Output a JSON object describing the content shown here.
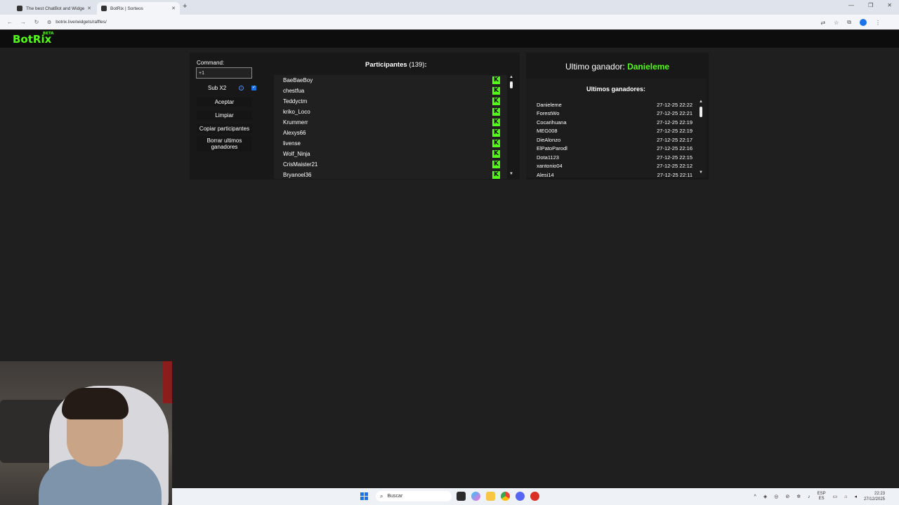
{
  "browser": {
    "tabs": [
      {
        "title": "The best ChatBot and Widgets"
      },
      {
        "title": "BotRix | Sorteos"
      }
    ],
    "url": "botrix.live/widgets/raffles/"
  },
  "app": {
    "logo": "BotRix",
    "logo_badge": "BETA"
  },
  "controls": {
    "command_label": "Command:",
    "command_value": "+1",
    "sub_label": "Sub X2",
    "sub_checked": true,
    "accept_label": "Aceptar",
    "clear_label": "Limpiar",
    "copy_label": "Copiar participantes",
    "delete_label": "Borrar ultimos ganadores"
  },
  "participants": {
    "title": "Participantes",
    "count": "(139)",
    "names": [
      "BaeBaeBoy",
      "chestfua",
      "Teddyctm",
      "kriko_Loco",
      "Krummerr",
      "Alexys66",
      "livense",
      "Wolf_Ninja",
      "CrisMaister21",
      "Bryanoel36"
    ]
  },
  "winner": {
    "label": "Ultimo ganador:",
    "name": "Danieleme",
    "history_title": "Ultimos ganadores:",
    "history": [
      {
        "name": "Danieleme",
        "time": "27-12-25 22:22"
      },
      {
        "name": "ForestWo",
        "time": "27-12-25 22:21"
      },
      {
        "name": "Cocarihuana",
        "time": "27-12-25 22:19"
      },
      {
        "name": "MEG008",
        "time": "27-12-25 22:19"
      },
      {
        "name": "DieAlonzo",
        "time": "27-12-25 22:17"
      },
      {
        "name": "ElPatoParodl",
        "time": "27-12-25 22:16"
      },
      {
        "name": "Dota1123",
        "time": "27-12-25 22:15"
      },
      {
        "name": "xantonio04",
        "time": "27-12-25 22:12"
      },
      {
        "name": "Alesi14",
        "time": "27-12-25 22:11"
      }
    ]
  },
  "taskbar": {
    "search_placeholder": "Buscar",
    "lang_top": "ESP",
    "lang_bottom": "ES",
    "time": "22:23",
    "date": "27/12/2025"
  },
  "colors": {
    "accent": "#53fc18",
    "background": "#1f1f1f"
  }
}
